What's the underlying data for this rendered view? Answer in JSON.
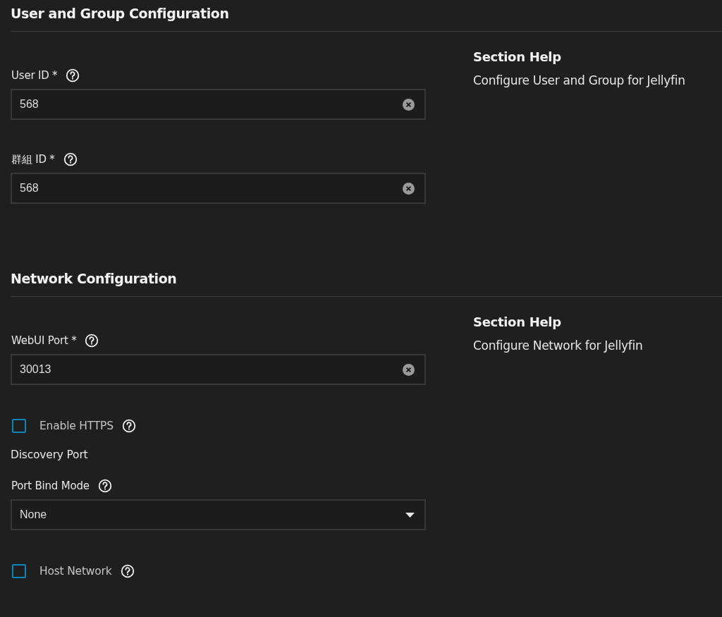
{
  "sections": [
    {
      "title": "User and Group Configuration",
      "help": {
        "title": "Section Help",
        "text": "Configure User and Group for Jellyfin"
      },
      "fields": [
        {
          "kind": "text",
          "label": "User ID *",
          "value": "568"
        },
        {
          "kind": "text",
          "label": "群組 ID *",
          "value": "568"
        }
      ]
    },
    {
      "title": "Network Configuration",
      "help": {
        "title": "Section Help",
        "text": "Configure Network for Jellyfin"
      },
      "fields": [
        {
          "kind": "text",
          "label": "WebUI Port *",
          "value": "30013"
        },
        {
          "kind": "checkbox",
          "label": "Enable HTTPS",
          "checked": false
        },
        {
          "kind": "heading",
          "label": "Discovery Port"
        },
        {
          "kind": "select",
          "label": "Port Bind Mode",
          "value": "None"
        },
        {
          "kind": "checkbox",
          "label": "Host Network",
          "checked": false
        }
      ]
    }
  ]
}
